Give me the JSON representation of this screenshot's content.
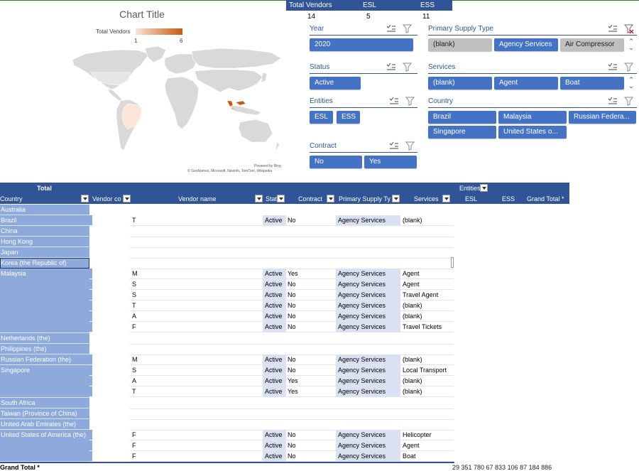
{
  "chart": {
    "title": "Chart Title",
    "legend_label": "Total Vendors",
    "legend_min": "1",
    "legend_max": "6",
    "legend_colors": [
      "#fbe5d6",
      "#c55a11"
    ],
    "powered_by": "Powered by Bing",
    "credits": "© GeoNames, Microsoft, Navinfo, TomTom, Wikipedia",
    "highlighted_countries": [
      "Brazil",
      "Malaysia",
      "Singapore"
    ]
  },
  "kpi": {
    "headers": [
      "Total Vendors",
      "ESL",
      "ESS"
    ],
    "values": [
      "14",
      "5",
      "11"
    ]
  },
  "slicers": {
    "year": {
      "title": "Year",
      "items": [
        "2020"
      ]
    },
    "status": {
      "title": "Status",
      "items": [
        "Active"
      ]
    },
    "entities": {
      "title": "Entities",
      "items": [
        "ESL",
        "ESS"
      ]
    },
    "contract": {
      "title": "Contract",
      "items": [
        "No",
        "Yes"
      ]
    },
    "primary_supply_type": {
      "title": "Primary Supply Type",
      "items": [
        "(blank)",
        "Agency Services",
        "Air Compressor"
      ]
    },
    "services": {
      "title": "Services",
      "items": [
        "(blank)",
        "Agent",
        "Boat"
      ]
    },
    "country": {
      "title": "Country",
      "items": [
        "Brazil",
        "Malaysia",
        "Russian Federa...",
        "Singapore",
        "United States o..."
      ]
    }
  },
  "pivot": {
    "header_total": "Total",
    "header_entities": "Entities",
    "columns": {
      "country": "Country",
      "vendor_code": "Vendor co",
      "vendor_name": "Vendor name",
      "status": "Stat",
      "contract": "Contract",
      "primary_supply_type": "Primary Supply Ty",
      "services": "Services",
      "esl": "ESL",
      "ess": "ESS",
      "grand_total": "Grand Total *"
    },
    "countries": [
      "Australia",
      "Brazil",
      "China",
      "Hong Kong",
      "Japan",
      "Korea (the Republic of)",
      "Malaysia",
      "Netherlands (the)",
      "Philippines (the)",
      "Russian Federation (the)",
      "Singapore",
      "South Africa",
      "Taiwan (Province of China)",
      "United Arab Emirates (the)",
      "United States of America (the)"
    ],
    "rows": [
      {
        "vendor": "T",
        "status": "Active",
        "contract": "No",
        "pst": "Agency Services",
        "service": "(blank)"
      },
      {
        "vendor": "M",
        "status": "Active",
        "contract": "Yes",
        "pst": "Agency Services",
        "service": "Agent"
      },
      {
        "vendor": "S",
        "status": "Active",
        "contract": "No",
        "pst": "Agency Services",
        "service": "Agent"
      },
      {
        "vendor": "S",
        "status": "Active",
        "contract": "No",
        "pst": "Agency Services",
        "service": "Travel Agent"
      },
      {
        "vendor": "T",
        "status": "Active",
        "contract": "No",
        "pst": "Agency Services",
        "service": "(blank)"
      },
      {
        "vendor": "A",
        "status": "Active",
        "contract": "No",
        "pst": "Agency Services",
        "service": "(blank)"
      },
      {
        "vendor": "F",
        "status": "Active",
        "contract": "No",
        "pst": "Agency Services",
        "service": "Travel Tickets"
      },
      {
        "vendor": "M",
        "status": "Active",
        "contract": "No",
        "pst": "Agency Services",
        "service": "(blank)"
      },
      {
        "vendor": "S",
        "status": "Active",
        "contract": "No",
        "pst": "Agency Services",
        "service": "Local Transport"
      },
      {
        "vendor": "A",
        "status": "Active",
        "contract": "Yes",
        "pst": "Agency Services",
        "service": "(blank)"
      },
      {
        "vendor": "T",
        "status": "Active",
        "contract": "Yes",
        "pst": "Agency Services",
        "service": "(blank)"
      },
      {
        "vendor": "F",
        "status": "Active",
        "contract": "No",
        "pst": "Agency Services",
        "service": "Helicopter"
      },
      {
        "vendor": "F",
        "status": "Active",
        "contract": "No",
        "pst": "Agency Services",
        "service": "Agent"
      },
      {
        "vendor": "F",
        "status": "Active",
        "contract": "No",
        "pst": "Agency Services",
        "service": "Boat"
      }
    ],
    "grand_total_label": "Grand Total *",
    "grand_total_values": "29 351 780   67 833 106    87 184 886"
  }
}
